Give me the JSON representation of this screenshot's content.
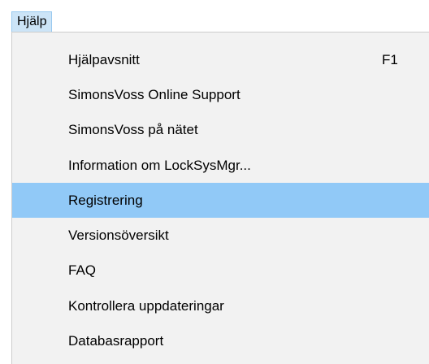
{
  "menubar": {
    "help_label": "Hjälp"
  },
  "menu": {
    "items": [
      {
        "label": "Hjälpavsnitt",
        "shortcut": "F1"
      },
      {
        "label": "SimonsVoss Online  Support",
        "shortcut": ""
      },
      {
        "label": "SimonsVoss på nätet",
        "shortcut": ""
      },
      {
        "label": "Information om LockSysMgr...",
        "shortcut": ""
      },
      {
        "label": "Registrering",
        "shortcut": "",
        "highlighted": true
      },
      {
        "label": "Versionsöversikt",
        "shortcut": ""
      },
      {
        "label": "FAQ",
        "shortcut": ""
      },
      {
        "label": "Kontrollera uppdateringar",
        "shortcut": ""
      },
      {
        "label": "Databasrapport",
        "shortcut": ""
      }
    ]
  },
  "colors": {
    "highlight": "#91c9f7",
    "menubar_active": "#cce4f7",
    "menu_background": "#f2f2f2"
  }
}
